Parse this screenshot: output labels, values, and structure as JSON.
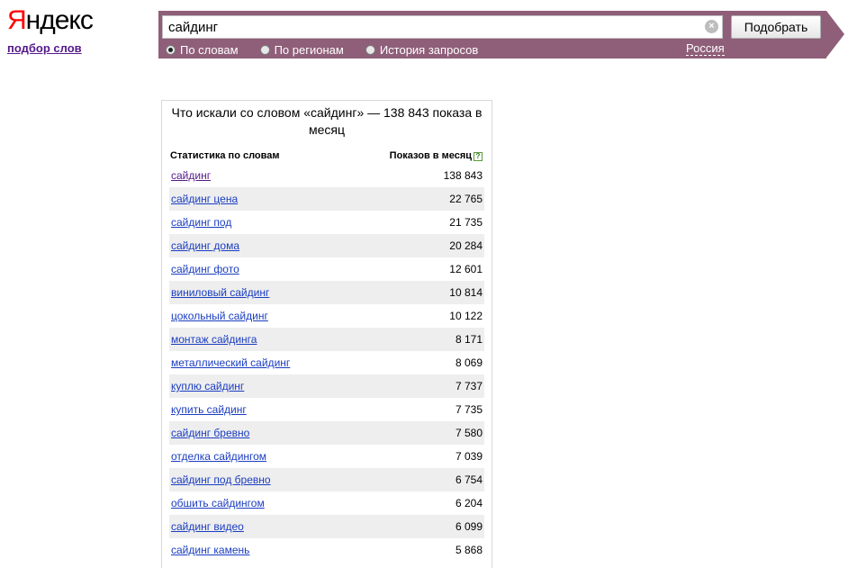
{
  "logo": {
    "word_first": "Я",
    "word_rest": "ндекс",
    "subtitle": "подбор слов"
  },
  "search": {
    "query": "сайдинг",
    "submit_label": "Подобрать",
    "clear_glyph": "×",
    "options": [
      {
        "label": "По словам",
        "checked": true
      },
      {
        "label": "По регионам",
        "checked": false
      },
      {
        "label": "История запросов",
        "checked": false
      }
    ],
    "region": "Россия"
  },
  "results": {
    "title": "Что искали со словом «сайдинг» — 138 843 показа в месяц",
    "col_keywords": "Статистика по словам",
    "col_shows": "Показов в месяц",
    "help_glyph": "?",
    "rows": [
      {
        "phrase": "сайдинг",
        "count": "138 843"
      },
      {
        "phrase": "сайдинг цена",
        "count": "22 765"
      },
      {
        "phrase": "сайдинг под",
        "count": "21 735"
      },
      {
        "phrase": "сайдинг дома",
        "count": "20 284"
      },
      {
        "phrase": "сайдинг фото",
        "count": "12 601"
      },
      {
        "phrase": "виниловый сайдинг",
        "count": "10 814"
      },
      {
        "phrase": "цокольный сайдинг",
        "count": "10 122"
      },
      {
        "phrase": "монтаж сайдинга",
        "count": "8 171"
      },
      {
        "phrase": "металлический сайдинг",
        "count": "8 069"
      },
      {
        "phrase": "куплю сайдинг",
        "count": "7 737"
      },
      {
        "phrase": "купить сайдинг",
        "count": "7 735"
      },
      {
        "phrase": "сайдинг бревно",
        "count": "7 580"
      },
      {
        "phrase": "отделка сайдингом",
        "count": "7 039"
      },
      {
        "phrase": "сайдинг под бревно",
        "count": "6 754"
      },
      {
        "phrase": "обшить сайдингом",
        "count": "6 204"
      },
      {
        "phrase": "сайдинг видео",
        "count": "6 099"
      },
      {
        "phrase": "сайдинг камень",
        "count": "5 868"
      }
    ]
  },
  "colors": {
    "bar": "#8f5f79",
    "link": "#1a3dc1",
    "visited": "#551a8b",
    "logo_red": "#ff0000"
  }
}
